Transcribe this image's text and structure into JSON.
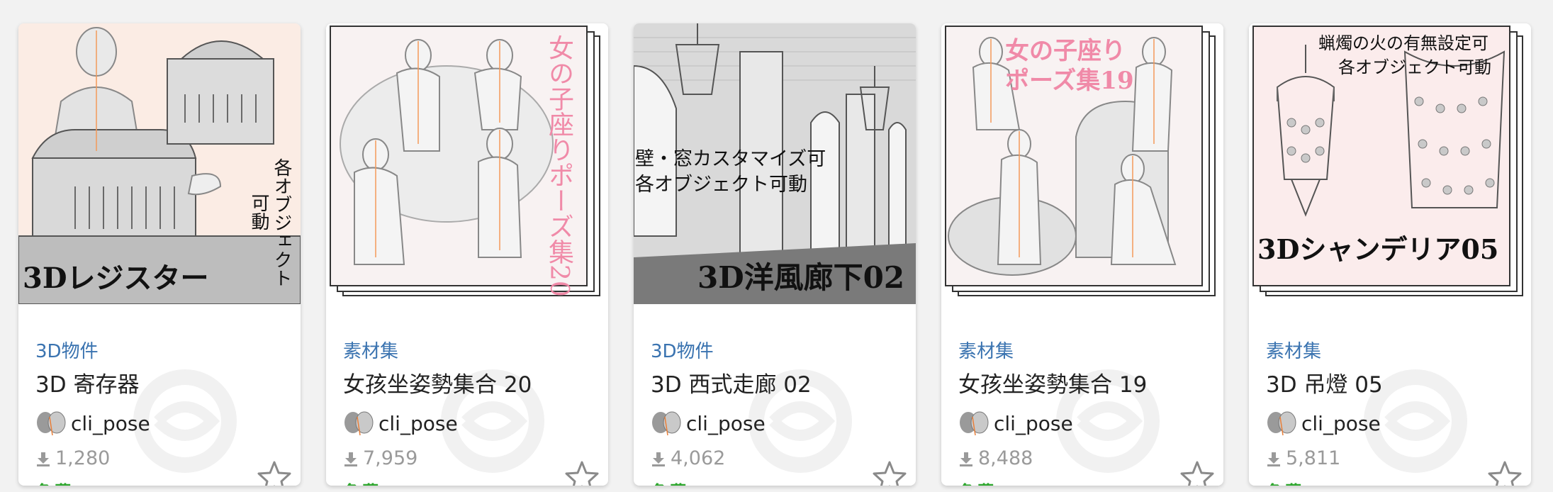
{
  "cards": [
    {
      "captions": [
        "3Dレジスター",
        "各オブジェクト",
        "可動"
      ],
      "category": "3D物件",
      "title": "3D 寄存器",
      "author": "cli_pose",
      "downloads": "1,280",
      "price": "免費"
    },
    {
      "captions": [
        "女の子座りポーズ集20"
      ],
      "category": "素材集",
      "title": "女孩坐姿勢集合 20",
      "author": "cli_pose",
      "downloads": "7,959",
      "price": "免費"
    },
    {
      "captions": [
        "壁・窓カスタマイズ可",
        "各オブジェクト可動",
        "3D洋風廊下02"
      ],
      "category": "3D物件",
      "title": "3D 西式走廊 02",
      "author": "cli_pose",
      "downloads": "4,062",
      "price": "免費"
    },
    {
      "captions": [
        "女の子座り",
        "ポーズ集19"
      ],
      "category": "素材集",
      "title": "女孩坐姿勢集合 19",
      "author": "cli_pose",
      "downloads": "8,488",
      "price": "免費"
    },
    {
      "captions": [
        "蝋燭の火の有無設定可",
        "各オブジェクト可動",
        "3Dシャンデリア05"
      ],
      "category": "素材集",
      "title": "3D 吊燈 05",
      "author": "cli_pose",
      "downloads": "5,811",
      "price": "免費"
    }
  ],
  "icons": {
    "download": "download-icon",
    "favorite": "star-outline-icon",
    "watermark": "clip-studio-logo-watermark"
  },
  "colors": {
    "category": "#3a73b0",
    "price": "#2ea72e",
    "meta": "#9a9a9a",
    "pink_caption": "#f08aa8"
  }
}
